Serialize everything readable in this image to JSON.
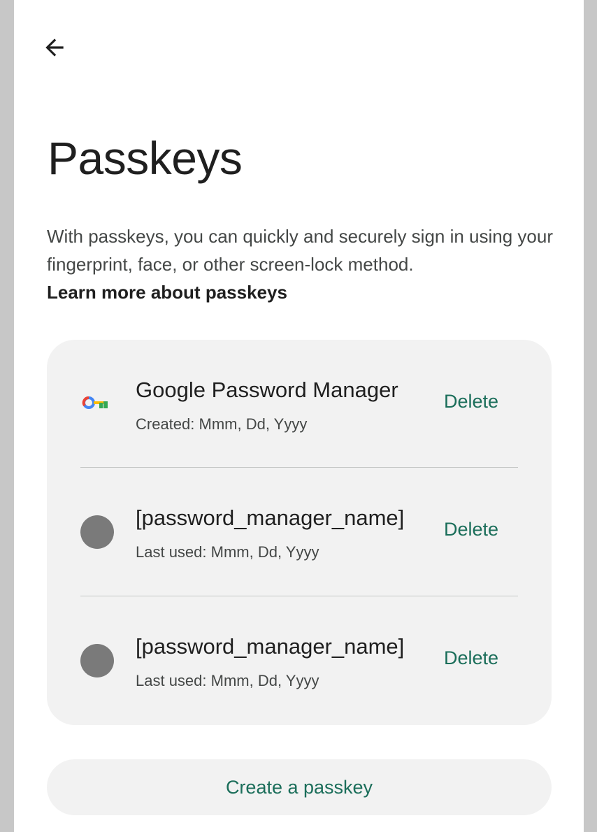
{
  "header": {
    "back_icon": "arrow-left-icon",
    "title": "Passkeys"
  },
  "intro": {
    "description": "With passkeys, you can quickly and securely sign in using your fingerprint, face, or other screen-lock method.",
    "learn_more": "Learn more about passkeys"
  },
  "passkeys": [
    {
      "icon": "google-password-manager-key-icon",
      "title": "Google Password Manager",
      "subtitle": "Created: Mmm, Dd, Yyyy",
      "action": "Delete"
    },
    {
      "icon": "placeholder-circle-icon",
      "title": "[password_manager_name]",
      "subtitle": "Last used: Mmm, Dd, Yyyy",
      "action": "Delete"
    },
    {
      "icon": "placeholder-circle-icon",
      "title": "[password_manager_name]",
      "subtitle": "Last used: Mmm, Dd, Yyyy",
      "action": "Delete"
    }
  ],
  "footer": {
    "create_label": "Create a passkey"
  },
  "colors": {
    "accent": "#1b6e5a",
    "surface": "#f2f2f2",
    "text_primary": "#1f1f1f",
    "text_secondary": "#444746",
    "placeholder_icon": "#7a7a7a",
    "frame": "#c7c7c7"
  }
}
